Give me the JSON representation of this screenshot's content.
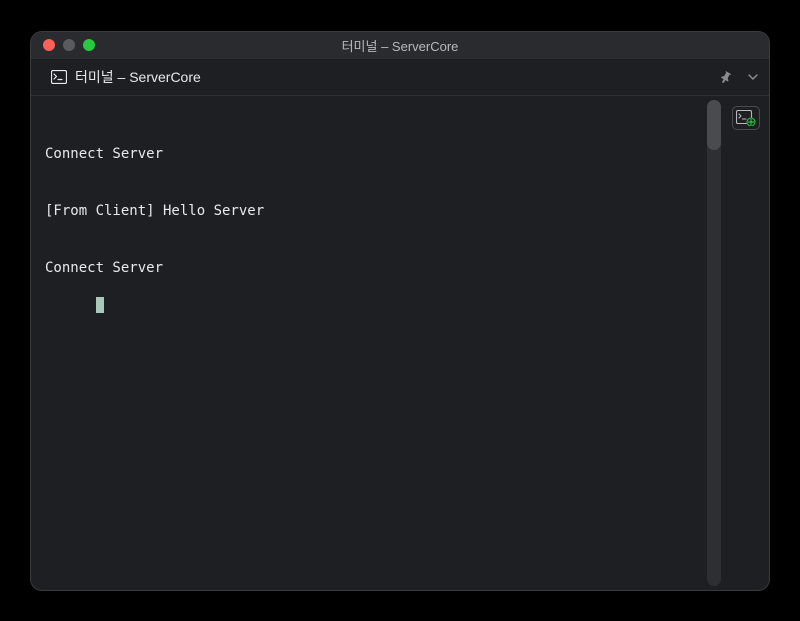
{
  "window": {
    "title": "터미널 – ServerCore"
  },
  "tab": {
    "label": "터미널 – ServerCore"
  },
  "terminal": {
    "lines": [
      "Connect Server",
      "[From Client] Hello Server",
      "Connect Server"
    ]
  },
  "icons": {
    "terminal": "terminal-icon",
    "pin": "pin-icon",
    "chevron": "chevron-down-icon",
    "newTab": "new-terminal-icon"
  }
}
